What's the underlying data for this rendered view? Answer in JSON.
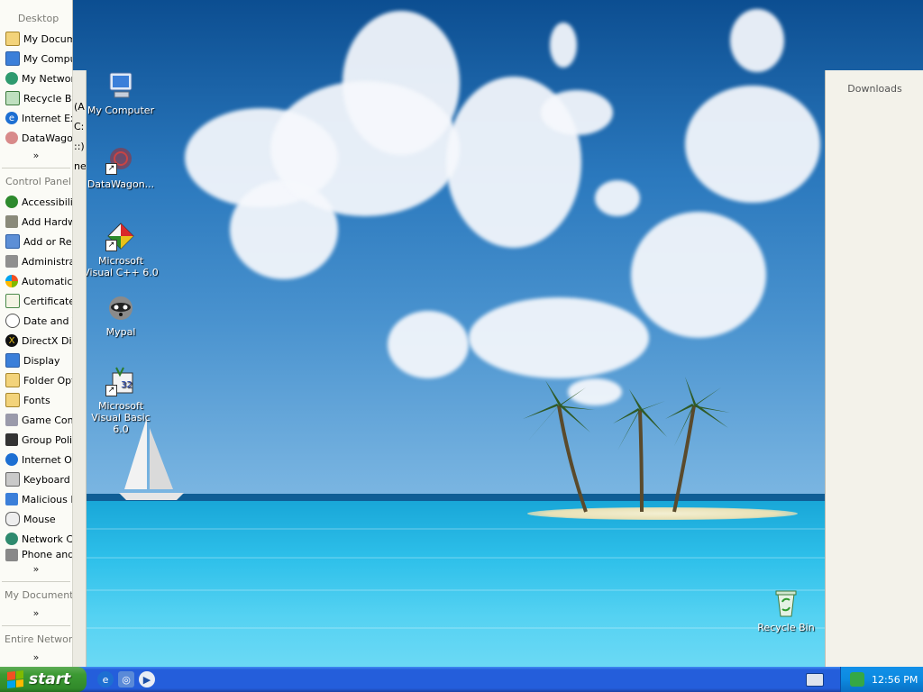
{
  "left_bar": {
    "sections": [
      {
        "title": "Desktop",
        "items": [
          {
            "label": "My Documents",
            "icon": "my-documents-icon"
          },
          {
            "label": "My Computer",
            "icon": "my-computer-icon"
          },
          {
            "label": "My Network Places",
            "icon": "network-icon"
          },
          {
            "label": "Recycle Bin",
            "icon": "recycle-bin-icon"
          },
          {
            "label": "Internet Explorer",
            "icon": "internet-explorer-icon"
          },
          {
            "label": "DataWagon",
            "icon": "datawagon-icon"
          }
        ],
        "more": "»"
      },
      {
        "title": "Control Panel",
        "items": [
          {
            "label": "Accessibility Options",
            "icon": "accessibility-icon"
          },
          {
            "label": "Add Hardware",
            "icon": "add-hardware-icon"
          },
          {
            "label": "Add or Remove Programs",
            "icon": "add-remove-programs-icon"
          },
          {
            "label": "Administrative Tools",
            "icon": "administrative-tools-icon"
          },
          {
            "label": "Automatic Updates",
            "icon": "automatic-updates-icon"
          },
          {
            "label": "Certificate Manager",
            "icon": "certificate-icon"
          },
          {
            "label": "Date and Time",
            "icon": "date-time-icon"
          },
          {
            "label": "DirectX Diagnostic",
            "icon": "directx-icon"
          },
          {
            "label": "Display",
            "icon": "display-icon"
          },
          {
            "label": "Folder Options",
            "icon": "folder-options-icon"
          },
          {
            "label": "Fonts",
            "icon": "fonts-icon"
          },
          {
            "label": "Game Controllers",
            "icon": "game-controllers-icon"
          },
          {
            "label": "Group Policy",
            "icon": "group-policy-icon"
          },
          {
            "label": "Internet Options",
            "icon": "internet-options-icon"
          },
          {
            "label": "Keyboard",
            "icon": "keyboard-icon"
          },
          {
            "label": "Malicious Removal",
            "icon": "malicious-removal-icon"
          },
          {
            "label": "Mouse",
            "icon": "mouse-icon"
          },
          {
            "label": "Network Connections",
            "icon": "network-connections-icon"
          },
          {
            "label": "Phone and Modem",
            "icon": "phone-modem-icon"
          }
        ],
        "more": "»"
      },
      {
        "title": "My Documents",
        "items": [],
        "more": "»"
      },
      {
        "title": "Entire Network",
        "items": [],
        "more": "»"
      }
    ],
    "clipped_fragments": [
      "(A",
      "C:",
      "::)",
      "nel"
    ]
  },
  "right_bar": {
    "title": "Downloads"
  },
  "desktop_icons": [
    {
      "label": "My Computer",
      "icon": "my-computer-icon",
      "shortcut": false
    },
    {
      "label": "DataWagon...",
      "icon": "datawagon-icon",
      "shortcut": true
    },
    {
      "label": "Microsoft Visual C++ 6.0",
      "icon": "visual-cpp-icon",
      "shortcut": true
    },
    {
      "label": "Mypal",
      "icon": "mypal-raccoon-icon",
      "shortcut": false
    },
    {
      "label": "Microsoft Visual Basic 6.0",
      "icon": "visual-basic-icon",
      "shortcut": true
    },
    {
      "label": "Recycle Bin",
      "icon": "recycle-bin-icon",
      "shortcut": false
    }
  ],
  "taskbar": {
    "start_label": "start",
    "quick_launch": [
      "internet-explorer-icon",
      "browser-icon",
      "media-player-icon"
    ],
    "tray": {
      "time": "12:56 PM",
      "icons": [
        "keyboard-icon",
        "network-icon"
      ]
    }
  },
  "colors": {
    "taskbar": "#245edb",
    "start_button": "#3c9a33",
    "tray": "#0c8ae0",
    "explorer_bar": "#fbfbf6"
  }
}
